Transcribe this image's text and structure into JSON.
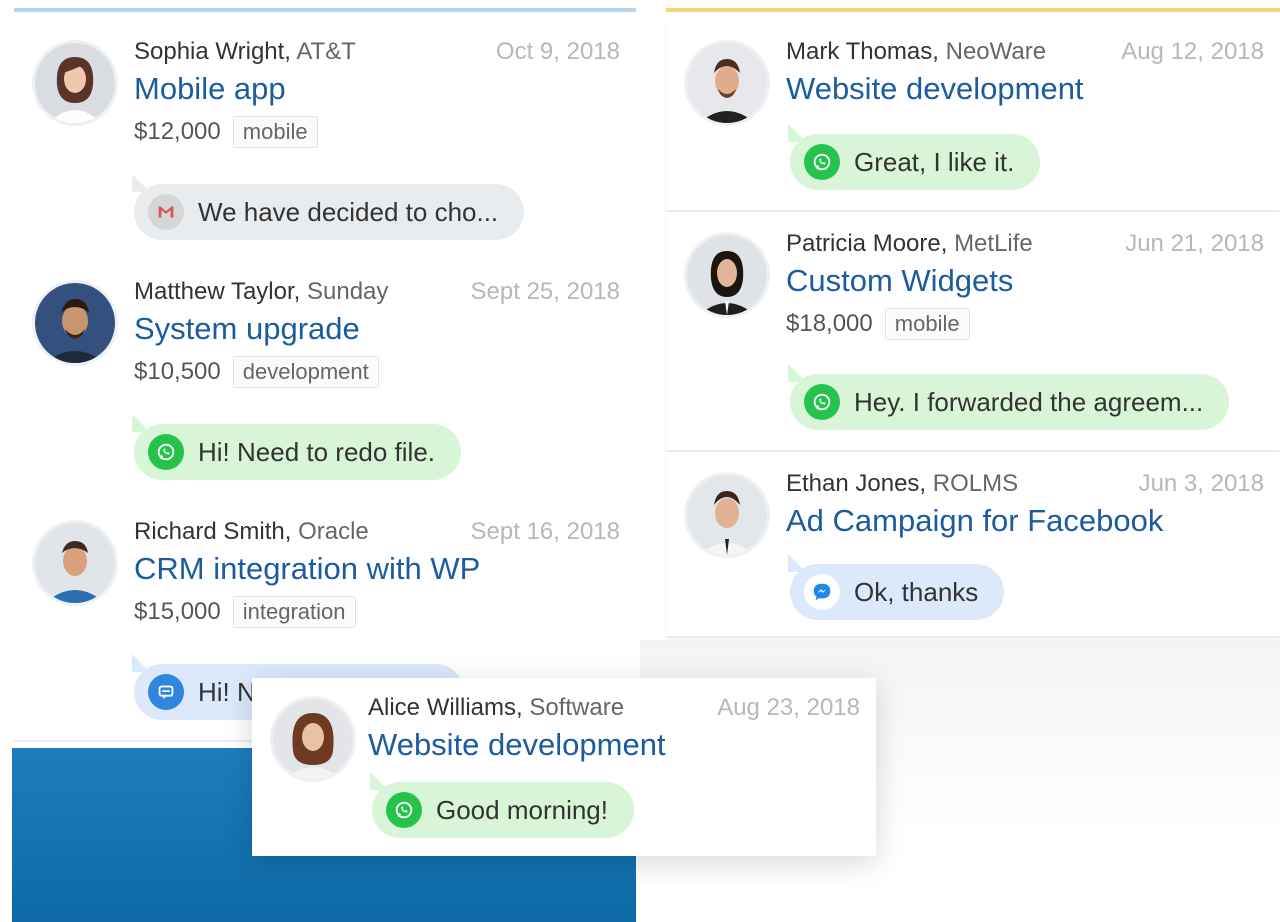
{
  "colors": {
    "left_column_accent": "#b9d5ee",
    "right_column_accent": "#f2d676",
    "title_link": "#1c5c9e",
    "whatsapp_green": "#25c24c",
    "whatsapp_bubble": "#d8f5d8",
    "messenger_bubble": "#dbe9fb",
    "gmail_bubble": "#e9ecef",
    "blue_block": "#1471b0"
  },
  "left_column": [
    {
      "name": "Sophia Wright,",
      "company": "AT&T",
      "date": "Oct 9, 2018",
      "title": "Mobile app",
      "amount": "$12,000",
      "tag": "mobile",
      "channel_icon": "gmail-icon",
      "message": "We have decided to cho..."
    },
    {
      "name": "Matthew Taylor,",
      "company": "Sunday",
      "date": "Sept 25, 2018",
      "title": "System upgrade",
      "amount": "$10,500",
      "tag": "development",
      "channel_icon": "whatsapp-icon",
      "message": "Hi! Need to redo file."
    },
    {
      "name": "Richard Smith,",
      "company": "Oracle",
      "date": "Sept 16, 2018",
      "title": "CRM integration with WP",
      "amount": "$15,000",
      "tag": "integration",
      "channel_icon": "chat-icon",
      "message": "Hi! N"
    }
  ],
  "right_column": [
    {
      "name": "Mark Thomas,",
      "company": "NeoWare",
      "date": "Aug 12, 2018",
      "title": "Website development",
      "channel_icon": "whatsapp-icon",
      "message": "Great, I like it."
    },
    {
      "name": "Patricia Moore,",
      "company": "MetLife",
      "date": "Jun 21, 2018",
      "title": "Custom Widgets",
      "amount": "$18,000",
      "tag": "mobile",
      "channel_icon": "whatsapp-icon",
      "message": "Hey. I forwarded the agreem..."
    },
    {
      "name": "Ethan Jones,",
      "company": "ROLMS",
      "date": "Jun 3, 2018",
      "title": "Ad Campaign for Facebook",
      "channel_icon": "messenger-icon",
      "message": "Ok, thanks"
    }
  ],
  "floating_card": {
    "name": "Alice Williams,",
    "company": "Software",
    "date": "Aug 23, 2018",
    "title": "Website development",
    "channel_icon": "whatsapp-icon",
    "message": "Good morning!"
  }
}
